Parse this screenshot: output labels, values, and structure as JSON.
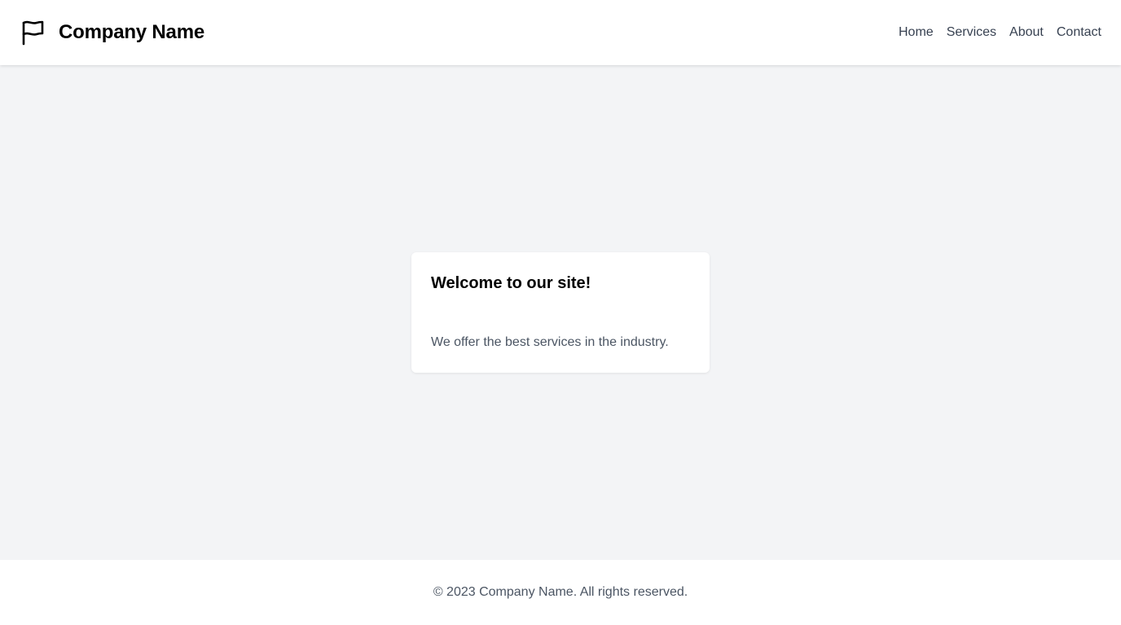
{
  "header": {
    "brand_icon": "flag-icon",
    "brand_name": "Company Name",
    "nav": [
      {
        "label": "Home"
      },
      {
        "label": "Services"
      },
      {
        "label": "About"
      },
      {
        "label": "Contact"
      }
    ]
  },
  "main": {
    "card": {
      "title": "Welcome to our site!",
      "text": "We offer the best services in the industry."
    }
  },
  "footer": {
    "text": "© 2023 Company Name. All rights reserved."
  },
  "colors": {
    "background": "#f3f4f6",
    "surface": "#ffffff",
    "heading": "#000000",
    "body_text": "#4b5563",
    "nav_text": "#374151"
  }
}
